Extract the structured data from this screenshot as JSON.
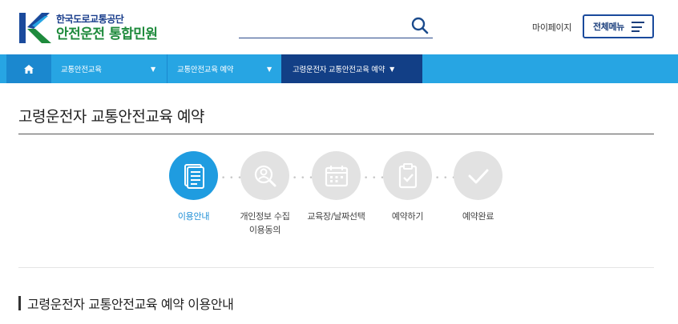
{
  "header": {
    "org_name": "한국도로교통공단",
    "site_title": "안전운전 통합민원",
    "mypage_label": "마이페이지",
    "allmenu_label": "전체메뉴"
  },
  "search": {
    "value": "",
    "placeholder": ""
  },
  "nav": {
    "home_icon": "home-icon",
    "items": [
      {
        "label": "교통안전교육"
      },
      {
        "label": "교통안전교육 예약"
      },
      {
        "label": "고령운전자 교통안전교육 예약"
      }
    ]
  },
  "page": {
    "title": "고령운전자 교통안전교육 예약",
    "section_title": "고령운전자 교통안전교육 예약 이용안내"
  },
  "steps": [
    {
      "label": "이용안내",
      "icon": "document-icon",
      "active": true
    },
    {
      "label_line1": "개인정보 수집",
      "label_line2": "이용동의",
      "icon": "magnifier-user-icon",
      "active": false
    },
    {
      "label": "교육장/날짜선택",
      "icon": "calendar-icon",
      "active": false
    },
    {
      "label": "예약하기",
      "icon": "clipboard-check-icon",
      "active": false
    },
    {
      "label": "예약완료",
      "icon": "check-icon",
      "active": false
    }
  ],
  "colors": {
    "nav_bg": "#27a5e3",
    "nav_active": "#123f86",
    "step_active": "#1f9ce0",
    "step_inactive": "#e2e2e2"
  }
}
